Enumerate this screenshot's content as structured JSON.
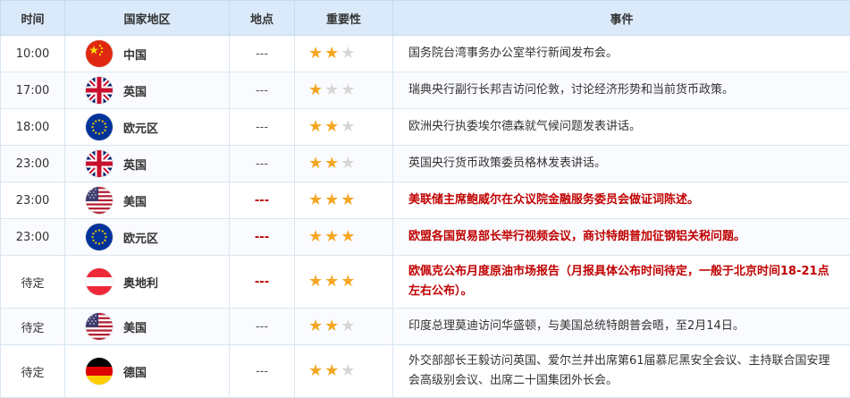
{
  "headers": {
    "time": "时间",
    "region": "国家地区",
    "location": "地点",
    "importance": "重要性",
    "event": "事件"
  },
  "rows": [
    {
      "time": "10:00",
      "flag": "china-flag-icon",
      "region": "中国",
      "location": "---",
      "stars": 2,
      "event": "国务院台湾事务办公室举行新闻发布会。",
      "highlight": false
    },
    {
      "time": "17:00",
      "flag": "uk-flag-icon",
      "region": "英国",
      "location": "---",
      "stars": 1,
      "event": "瑞典央行副行长邦吉访问伦敦，讨论经济形势和当前货币政策。",
      "highlight": false
    },
    {
      "time": "18:00",
      "flag": "eu-flag-icon",
      "region": "欧元区",
      "location": "---",
      "stars": 2,
      "event": "欧洲央行执委埃尔德森就气候问题发表讲话。",
      "highlight": false
    },
    {
      "time": "23:00",
      "flag": "uk-flag-icon",
      "region": "英国",
      "location": "---",
      "stars": 2,
      "event": "英国央行货币政策委员格林发表讲话。",
      "highlight": false
    },
    {
      "time": "23:00",
      "flag": "us-flag-icon",
      "region": "美国",
      "location": "---",
      "stars": 3,
      "event": "美联储主席鲍威尔在众议院金融服务委员会做证词陈述。",
      "highlight": true
    },
    {
      "time": "23:00",
      "flag": "eu-flag-icon",
      "region": "欧元区",
      "location": "---",
      "stars": 3,
      "event": "欧盟各国贸易部长举行视频会议，商讨特朗普加征钢铝关税问题。",
      "highlight": true
    },
    {
      "time": "待定",
      "flag": "austria-flag-icon",
      "region": "奥地利",
      "location": "---",
      "stars": 3,
      "event": "欧佩克公布月度原油市场报告（月报具体公布时间待定，一般于北京时间18-21点左右公布）。",
      "highlight": true,
      "tall": true
    },
    {
      "time": "待定",
      "flag": "us-flag-icon",
      "region": "美国",
      "location": "---",
      "stars": 2,
      "event": "印度总理莫迪访问华盛顿，与美国总统特朗普会晤，至2月14日。",
      "highlight": false
    },
    {
      "time": "待定",
      "flag": "germany-flag-icon",
      "region": "德国",
      "location": "---",
      "stars": 2,
      "event": "外交部部长王毅访问英国、爱尔兰并出席第61届慕尼黑安全会议、主持联合国安理会高级别会议、出席二十国集团外长会。",
      "highlight": false,
      "tall": true
    }
  ],
  "colors": {
    "header_bg": "#dbeafa",
    "highlight_text": "#c00000",
    "star_on": "#f5a623",
    "star_off": "#d6d6d6"
  }
}
